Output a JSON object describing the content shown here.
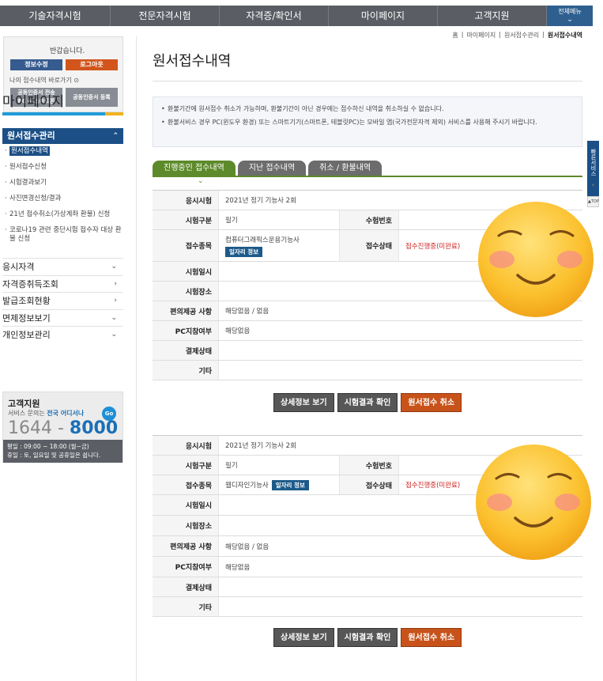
{
  "nav": {
    "items": [
      "기술자격시험",
      "전문자격시험",
      "자격증/확인서",
      "마이페이지",
      "고객지원"
    ],
    "all_menu": "전체메뉴"
  },
  "breadcrumb": [
    "홈",
    "마이페이지",
    "원서접수관리",
    "원서접수내역"
  ],
  "sidebar": {
    "hello": "반갑습니다.",
    "edit_btn": "정보수정",
    "logout_btn": "로그아웃",
    "shortcut": "나의 접수내역 바로가기",
    "cert_transfer_1": "공동인증서 전송",
    "cert_transfer_2": "PC ⇨ 스마트폰",
    "cert_register": "공동인증서 등록",
    "title": "마이페이지",
    "section": "원서접수관리",
    "subitems": [
      "원서접수내역",
      "원서접수신청",
      "시험결과보기",
      "사진변경신청/결과",
      "21년 접수취소(가상계좌 환불) 신청",
      "코로나19 관련 중단시험 접수자 대상 환불 신청"
    ],
    "menu": [
      "응시자격",
      "자격증취득조회",
      "발급조회현황",
      "면제정보보기",
      "개인정보관리"
    ],
    "support": {
      "title": "고객지원",
      "desc_prefix": "서비스 문의는",
      "desc_strong": "전국 어디서나",
      "go": "Go",
      "phone_a": "1644 - ",
      "phone_b": "8000",
      "hours_1": "평일 : 09:00 ~ 18:00 (월~금)",
      "hours_2": "휴일 : 토, 일요일 및 공휴일은 쉽니다."
    }
  },
  "main": {
    "title": "원서접수내역",
    "notice_1": "환불기간에 원서접수 취소가 가능하며, 환불기간이 아닌 경우에는 접수하신 내역을 취소하실 수 없습니다.",
    "notice_2": "환불서비스 경우 PC(윈도우 환경) 또는 스마트기기(스마트폰, 테블릿PC)는 모바일 앱(국가전문자격 제외) 서비스를 사용해 주시기 바랍니다.",
    "tabs": [
      "진행중인 접수내역",
      "지난 접수내역",
      "취소 / 환불내역"
    ]
  },
  "labels": {
    "exam": "응시시험",
    "type": "시험구분",
    "exam_no": "수험번호",
    "subject": "접수종목",
    "status": "접수상태",
    "date": "시험일시",
    "place": "시험장소",
    "convenience": "편의제공 사항",
    "pc": "PC지참여부",
    "payment": "결제상태",
    "etc": "기타",
    "job_info": "일자리 정보"
  },
  "records": [
    {
      "exam": "2021년 정기 기능사 2회",
      "type": "필기",
      "exam_no": "",
      "subject": "컴퓨터그래픽스운용기능사",
      "status": "접수진행중(미완료)",
      "convenience": "해당없음 / 없음",
      "pc": "해당없음"
    },
    {
      "exam": "2021년 정기 기능사 2회",
      "type": "필기",
      "exam_no": "",
      "subject": "웹디자인기능사",
      "status": "접수진행중(미완료)",
      "convenience": "해당없음 / 없음",
      "pc": "해당없음"
    }
  ],
  "actions": [
    "상세정보 보기",
    "시험결과 확인",
    "원서접수 취소"
  ],
  "quick": {
    "label": "빠른서비스",
    "top": "TOP"
  },
  "colors": {
    "nav_bg": "#5a5d64",
    "primary": "#1b4f86",
    "tab_active": "#5d8a2a",
    "accent_orange": "#c8531a",
    "status_red": "#d02020"
  }
}
